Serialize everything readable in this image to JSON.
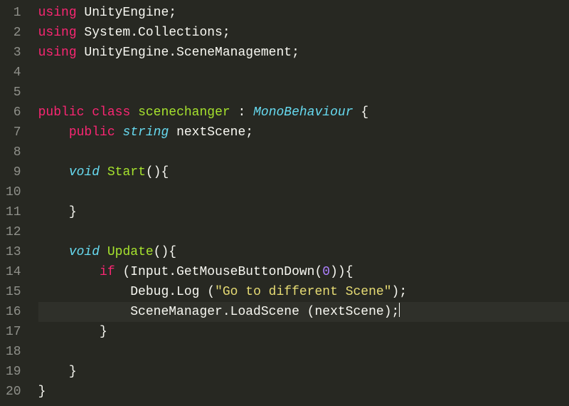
{
  "editor": {
    "line_count": 20,
    "active_line": 16,
    "lines": [
      {
        "n": 1,
        "tokens": [
          {
            "cls": "kw",
            "t": "using"
          },
          {
            "cls": "plain",
            "t": " UnityEngine;"
          }
        ]
      },
      {
        "n": 2,
        "tokens": [
          {
            "cls": "kw",
            "t": "using"
          },
          {
            "cls": "plain",
            "t": " System.Collections;"
          }
        ]
      },
      {
        "n": 3,
        "tokens": [
          {
            "cls": "kw",
            "t": "using"
          },
          {
            "cls": "plain",
            "t": " UnityEngine.SceneManagement;"
          }
        ]
      },
      {
        "n": 4,
        "tokens": []
      },
      {
        "n": 5,
        "tokens": []
      },
      {
        "n": 6,
        "tokens": [
          {
            "cls": "kw",
            "t": "public"
          },
          {
            "cls": "plain",
            "t": " "
          },
          {
            "cls": "kw",
            "t": "class"
          },
          {
            "cls": "plain",
            "t": " "
          },
          {
            "cls": "fn",
            "t": "scenechanger"
          },
          {
            "cls": "plain",
            "t": " : "
          },
          {
            "cls": "type",
            "t": "MonoBehaviour"
          },
          {
            "cls": "plain",
            "t": " {"
          }
        ]
      },
      {
        "n": 7,
        "tokens": [
          {
            "cls": "plain",
            "t": "    "
          },
          {
            "cls": "kw",
            "t": "public"
          },
          {
            "cls": "plain",
            "t": " "
          },
          {
            "cls": "type",
            "t": "string"
          },
          {
            "cls": "plain",
            "t": " nextScene;"
          }
        ]
      },
      {
        "n": 8,
        "tokens": []
      },
      {
        "n": 9,
        "tokens": [
          {
            "cls": "plain",
            "t": "    "
          },
          {
            "cls": "type",
            "t": "void"
          },
          {
            "cls": "plain",
            "t": " "
          },
          {
            "cls": "fn",
            "t": "Start"
          },
          {
            "cls": "plain",
            "t": "(){"
          }
        ]
      },
      {
        "n": 10,
        "tokens": []
      },
      {
        "n": 11,
        "tokens": [
          {
            "cls": "plain",
            "t": "    }"
          }
        ]
      },
      {
        "n": 12,
        "tokens": []
      },
      {
        "n": 13,
        "tokens": [
          {
            "cls": "plain",
            "t": "    "
          },
          {
            "cls": "type",
            "t": "void"
          },
          {
            "cls": "plain",
            "t": " "
          },
          {
            "cls": "fn",
            "t": "Update"
          },
          {
            "cls": "plain",
            "t": "(){"
          }
        ]
      },
      {
        "n": 14,
        "tokens": [
          {
            "cls": "plain",
            "t": "        "
          },
          {
            "cls": "kw",
            "t": "if"
          },
          {
            "cls": "plain",
            "t": " (Input.GetMouseButtonDown("
          },
          {
            "cls": "num",
            "t": "0"
          },
          {
            "cls": "plain",
            "t": ")){"
          }
        ]
      },
      {
        "n": 15,
        "tokens": [
          {
            "cls": "plain",
            "t": "            Debug.Log ("
          },
          {
            "cls": "str",
            "t": "\"Go to different Scene\""
          },
          {
            "cls": "plain",
            "t": ");"
          }
        ]
      },
      {
        "n": 16,
        "tokens": [
          {
            "cls": "plain",
            "t": "            SceneManager.LoadScene (nextScene);"
          }
        ],
        "cursor": true
      },
      {
        "n": 17,
        "tokens": [
          {
            "cls": "plain",
            "t": "        }"
          }
        ]
      },
      {
        "n": 18,
        "tokens": []
      },
      {
        "n": 19,
        "tokens": [
          {
            "cls": "plain",
            "t": "    }"
          }
        ]
      },
      {
        "n": 20,
        "tokens": [
          {
            "cls": "plain",
            "t": "}"
          }
        ]
      }
    ]
  }
}
